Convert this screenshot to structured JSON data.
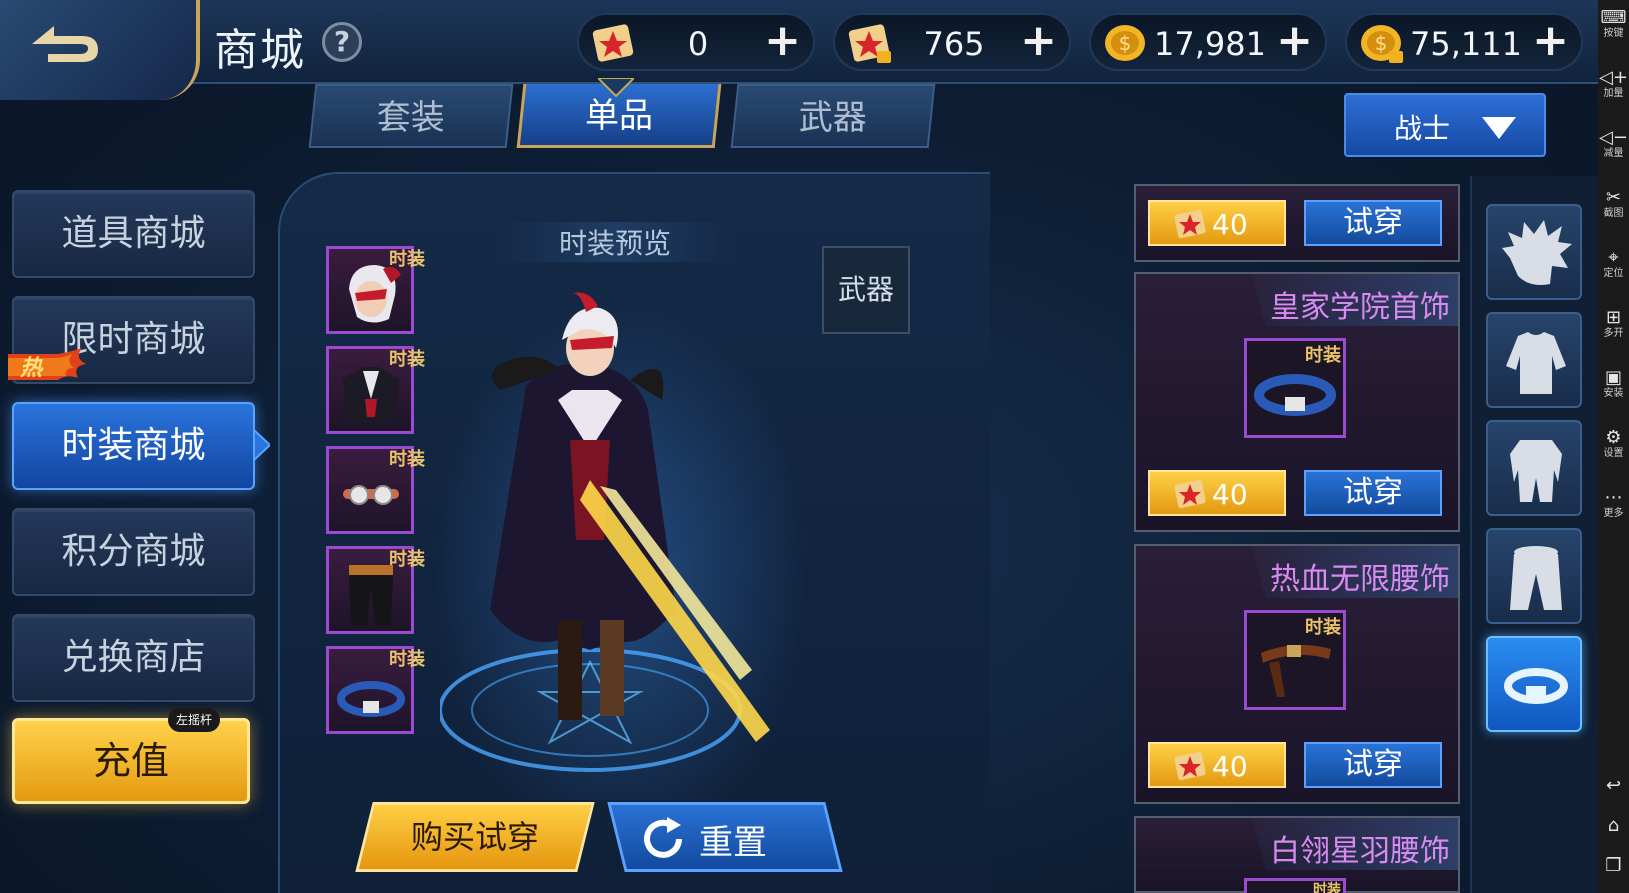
{
  "header": {
    "title": "商城",
    "help_label": "?",
    "currencies": [
      {
        "icon": "red-scroll-icon",
        "value": "0"
      },
      {
        "icon": "locked-scroll-icon",
        "value": "765"
      },
      {
        "icon": "gold-coin-icon",
        "value": "17,981"
      },
      {
        "icon": "locked-gold-coin-icon",
        "value": "75,111"
      }
    ],
    "plus_label": "+"
  },
  "tabs": [
    {
      "label": "套装",
      "active": false
    },
    {
      "label": "单品",
      "active": true
    },
    {
      "label": "武器",
      "active": false
    }
  ],
  "class_select": {
    "value": "战士"
  },
  "side_menu": [
    {
      "label": "道具商城",
      "active": false
    },
    {
      "label": "限时商城",
      "active": false,
      "badge": "热"
    },
    {
      "label": "时装商城",
      "active": true
    },
    {
      "label": "积分商城",
      "active": false
    },
    {
      "label": "兑换商店",
      "active": false
    }
  ],
  "recharge": {
    "label": "充值",
    "hint": "左摇杆"
  },
  "preview": {
    "title": "时装预览",
    "weapon_button": "武器",
    "slot_tag": "时装",
    "slots": [
      "hair-mask-item",
      "costume-item",
      "goggles-item",
      "pants-item",
      "belt-item"
    ],
    "buy_button": "购买试穿",
    "reset_button": "重置"
  },
  "items": [
    {
      "name": "",
      "price": "40",
      "try_label": "试穿"
    },
    {
      "name": "皇家学院首饰",
      "price": "40",
      "try_label": "试穿",
      "tag": "时装"
    },
    {
      "name": "热血无限腰饰",
      "price": "40",
      "try_label": "试穿",
      "tag": "时装"
    },
    {
      "name": "白翎星羽腰饰",
      "tag": "时装"
    }
  ],
  "categories": [
    "hair-icon",
    "top-icon",
    "body-icon",
    "pants-icon",
    "belt-icon"
  ],
  "emulator": [
    {
      "icon": "keyboard-icon",
      "label": "按键"
    },
    {
      "icon": "volume-up-icon",
      "label": "加量"
    },
    {
      "icon": "volume-down-icon",
      "label": "减量"
    },
    {
      "icon": "scissors-icon",
      "label": "截图"
    },
    {
      "icon": "location-icon",
      "label": "定位"
    },
    {
      "icon": "multi-open-icon",
      "label": "多开"
    },
    {
      "icon": "apk-install-icon",
      "label": "安装"
    },
    {
      "icon": "settings-icon",
      "label": "设置"
    },
    {
      "icon": "more-icon",
      "label": "更多"
    }
  ],
  "colors": {
    "accent_gold": "#e5a21a",
    "accent_blue": "#2a72d6",
    "rarity_purple": "#9a4bd2"
  }
}
